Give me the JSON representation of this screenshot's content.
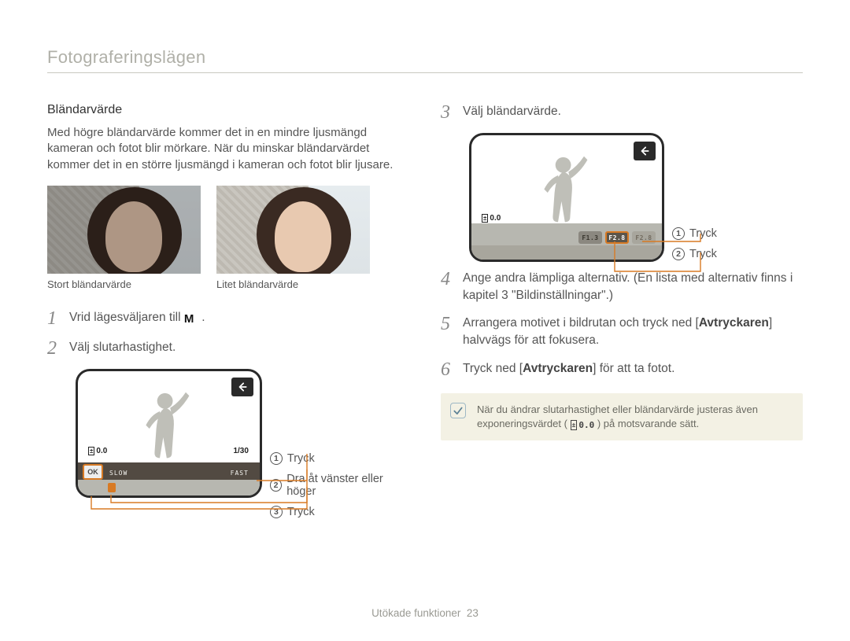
{
  "section_title": "Fotograferingslägen",
  "left": {
    "heading": "Bländarvärde",
    "paragraph": "Med högre bländarvärde kommer det in en mindre ljusmängd kameran och fotot blir mörkare. När du minskar bländarvärdet kommer det in en större ljusmängd i kameran och fotot blir ljusare.",
    "caption_large": "Stort bländarvärde",
    "caption_small": "Litet bländarvärde",
    "step1_prefix": "Vrid lägesväljaren till ",
    "step1_suffix": ".",
    "step2": "Välj slutarhastighet.",
    "screen1": {
      "ev": "0.0",
      "shutter": "1/30",
      "slow": "SLOW",
      "fast": "FAST",
      "ok": "OK"
    },
    "callouts": {
      "c1": "Tryck",
      "c2": "Dra åt vänster eller höger",
      "c3": "Tryck"
    }
  },
  "right": {
    "step3": "Välj bländarvärde.",
    "screen2": {
      "ev": "0.0",
      "fstops": [
        "F1.3",
        "F2.8",
        "F2.8"
      ]
    },
    "callouts": {
      "c1": "Tryck",
      "c2": "Tryck"
    },
    "step4": "Ange andra lämpliga alternativ. (En lista med alternativ finns i kapitel 3 \"Bildinställningar\".)",
    "step5_a": "Arrangera motivet i bildrutan och tryck ned [",
    "step5_b": "Avtryckaren",
    "step5_c": "] halvvägs för att fokusera.",
    "step6_a": "Tryck ned [",
    "step6_b": "Avtryckaren",
    "step6_c": "] för att ta fotot.",
    "note_a": "När du ändrar slutarhastighet eller bländarvärde justeras även exponeringsvärdet (",
    "note_ev": "0.0",
    "note_b": ") på motsvarande sätt."
  },
  "footer_label": "Utökade funktioner",
  "footer_page": "23"
}
